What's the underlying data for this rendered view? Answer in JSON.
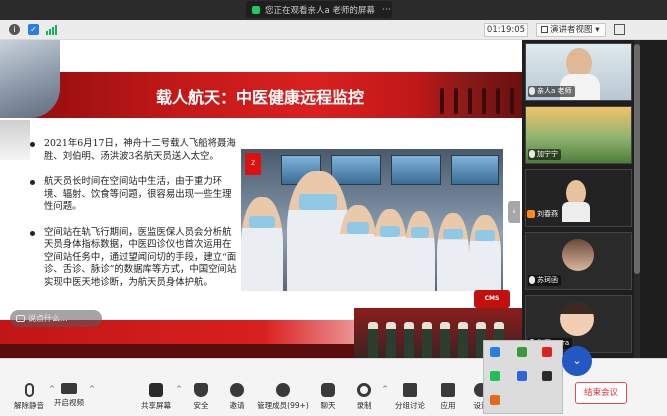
{
  "topbar": {
    "share_notice": "您正在观看亲人a 老师的屏幕",
    "more": "⋯"
  },
  "infobar": {
    "timer": "01:19:05",
    "view_mode": "演讲者视图"
  },
  "slide": {
    "title": "载人航天：中医健康远程监控",
    "bullets": [
      "2021年6月17日，神舟十二号载人飞船将聂海胜、刘伯明、汤洪波3名航天员送入太空。",
      "航天员长时间在空间站中生活，由于重力环境、辐射、饮食等问题，很容易出现一些生理性问题。",
      "空间站在轨飞行期间，医监医保人员会分析航天员身体指标数据，中医四诊仪也首次运用在空间站任务中，通过望闻问切的手段，建立“面诊、舌诊、脉诊”的数据库等方式，中国空间站实现中医天地诊断，为航天员身体护航。"
    ]
  },
  "comment": {
    "placeholder": "说点什么..."
  },
  "participants": [
    {
      "name": "亲人a 老师",
      "kind": "person"
    },
    {
      "name": "加宁宁",
      "kind": "landscape"
    },
    {
      "name": "刘春燕",
      "kind": "avatar"
    },
    {
      "name": "苏珂函",
      "kind": "photo"
    },
    {
      "name": "张国 aura",
      "kind": "child"
    },
    {
      "name": "",
      "kind": "dark"
    }
  ],
  "toolbar": {
    "items": [
      {
        "label": "解除静音",
        "icon": "mic-muted-icon"
      },
      {
        "label": "开启视频",
        "icon": "camera-off-icon"
      },
      {
        "label": "共享屏幕",
        "icon": "share-screen-icon"
      },
      {
        "label": "安全",
        "icon": "shield-icon"
      },
      {
        "label": "邀请",
        "icon": "invite-icon"
      },
      {
        "label": "管理成员(99+)",
        "icon": "members-icon"
      },
      {
        "label": "聊天",
        "icon": "chat-icon"
      },
      {
        "label": "录制",
        "icon": "record-icon"
      },
      {
        "label": "分组讨论",
        "icon": "breakout-icon"
      },
      {
        "label": "应用",
        "icon": "apps-icon"
      },
      {
        "label": "设置",
        "icon": "settings-icon"
      }
    ],
    "end_label": "结束会议"
  },
  "colors": {
    "banner_red": "#c41919",
    "panel_dark": "#1e1e1e",
    "end_red": "#e03030",
    "share_green": "#1ec762"
  }
}
